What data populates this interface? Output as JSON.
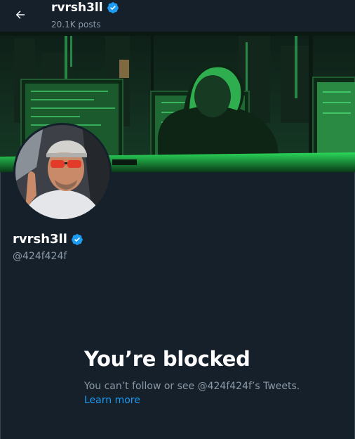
{
  "header": {
    "title": "rvrsh3ll",
    "subtitle": "20.1K posts",
    "back_icon": "arrow-left-icon"
  },
  "profile": {
    "display_name": "rvrsh3ll",
    "handle": "@424f424f",
    "verified_icon": "verified-badge-icon",
    "banner_image": "hooded-hacker-at-green-monitors",
    "avatar_image": "man-with-red-sunglasses-in-car"
  },
  "blocked": {
    "title": "You’re blocked",
    "description": "You can’t follow or see @424f424f’s Tweets.",
    "link_label": "Learn more"
  },
  "colors": {
    "background": "#15202b",
    "accent": "#1d9bf0",
    "muted_text": "#8b98a5",
    "banner_green": "#39ff6a"
  }
}
